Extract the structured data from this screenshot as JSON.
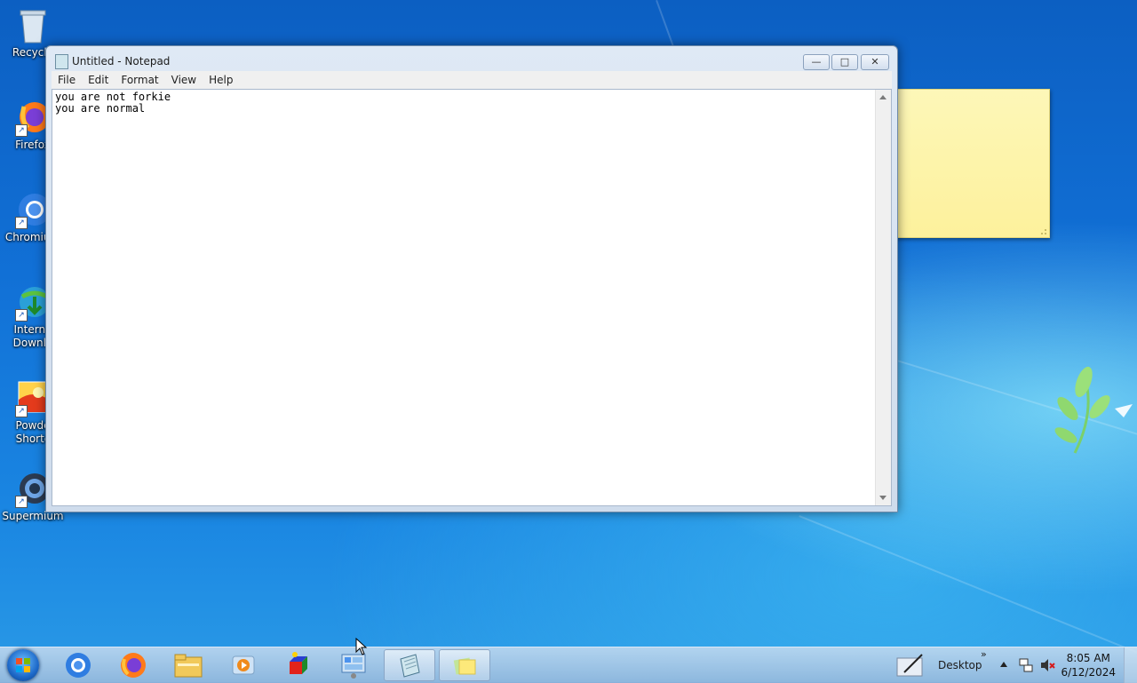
{
  "desktop": {
    "icons": [
      {
        "label": "Recycle",
        "icon": "recycle-bin-icon"
      },
      {
        "label": "Firefox",
        "icon": "firefox-icon"
      },
      {
        "label": "Chromium",
        "icon": "chromium-icon"
      },
      {
        "label": "Internet Downlo",
        "line1": "Interne",
        "line2": "Downlo",
        "icon": "download-manager-icon"
      },
      {
        "label": "Powder Shortcut",
        "line1": "Powde",
        "line2": "Shortc",
        "icon": "powder-icon"
      },
      {
        "label": "Supermium",
        "icon": "supermium-icon"
      }
    ]
  },
  "notepad": {
    "title": "Untitled - Notepad",
    "menu": [
      "File",
      "Edit",
      "Format",
      "View",
      "Help"
    ],
    "content": "you are not forkie\nyou are normal",
    "controls": {
      "minimize": "—",
      "maximize": "□",
      "close": "✕"
    }
  },
  "taskbar": {
    "items": [
      "start-button",
      "chromium",
      "firefox",
      "file-explorer",
      "media-player",
      "paint-3d-cube",
      "control-panel",
      "notepad",
      "sticky-notes"
    ],
    "desktop_label": "Desktop",
    "chevron": "»",
    "time": "8:05 AM",
    "date": "6/12/2024"
  },
  "colors": {
    "desktop_blue": "#1170d6",
    "sticky_yellow": "#fdf19c",
    "window_frame": "#cfdcec"
  }
}
